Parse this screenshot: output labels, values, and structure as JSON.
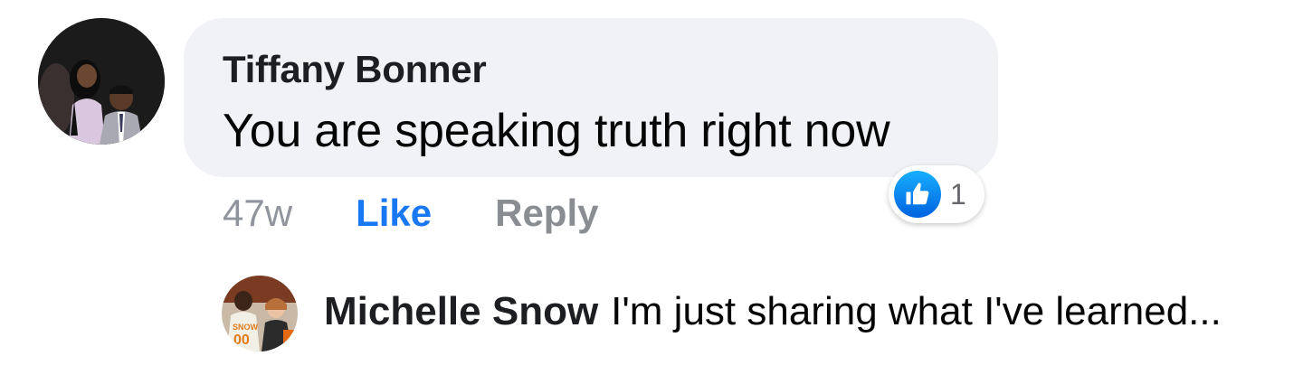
{
  "comment": {
    "author": "Tiffany Bonner",
    "text": "You are speaking truth right now",
    "timestamp": "47w",
    "like_label": "Like",
    "reply_label": "Reply",
    "reaction": {
      "icon": "thumbs-up-icon",
      "count": "1",
      "color": "#1877f2"
    }
  },
  "reply_preview": {
    "author": "Michelle Snow",
    "text": "I'm just sharing what I've learned..."
  }
}
